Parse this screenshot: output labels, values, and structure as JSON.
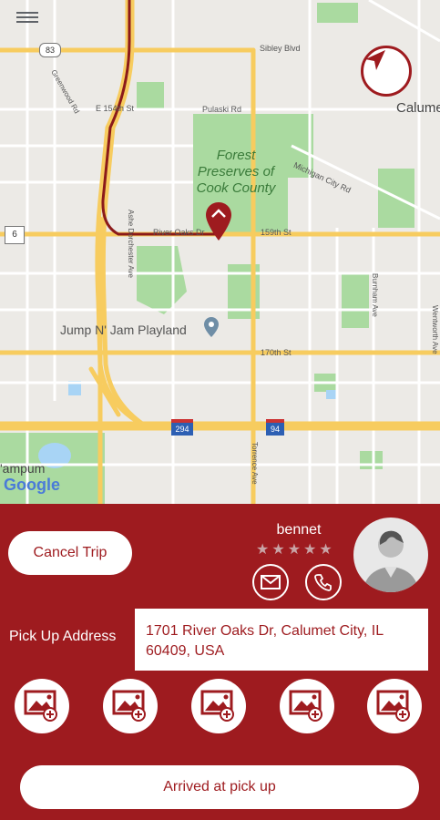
{
  "map": {
    "labels": {
      "sibley": "Sibley Blvd",
      "e154": "E 154th St",
      "pulaski": "Pulaski Rd",
      "calumet": "Calume",
      "forest": "Forest Preserves of Cook County",
      "michigan": "Michigan City Rd",
      "riveroaks": "River Oaks Dr",
      "st159": "159th St",
      "dolton": "Ashe Dorchester Ave",
      "burnham": "Burnham Ave",
      "wentworth": "Wentworth Ave",
      "jump": "Jump N' Jam Playland",
      "st170": "170th St",
      "torrence": "Torrence Ave",
      "greenwood": "Greenwood Rd",
      "tampum": "'ampum",
      "google": "Google"
    },
    "shields": {
      "r83": "83",
      "r6": "6",
      "i294": "294",
      "i94": "94"
    },
    "icons": {
      "menu": "hamburger-menu-icon",
      "locate": "navigation-arrow-icon",
      "pin": "map-pin-icon",
      "poi": "location-pin-icon"
    }
  },
  "panel": {
    "cancel_label": "Cancel Trip",
    "driver_name": "bennet",
    "rating": 0,
    "rating_max": 5,
    "pickup_label": "Pick Up Address",
    "pickup_address": "1701 River Oaks Dr, Calumet City, IL 60409, USA",
    "photo_slots": 5,
    "arrived_label": "Arrived at pick up"
  },
  "colors": {
    "brand": "#9e1b1f",
    "map_bg": "#eceae6",
    "park": "#aadaa0",
    "highway": "#f7cc5f",
    "water": "#a8d4f5"
  }
}
